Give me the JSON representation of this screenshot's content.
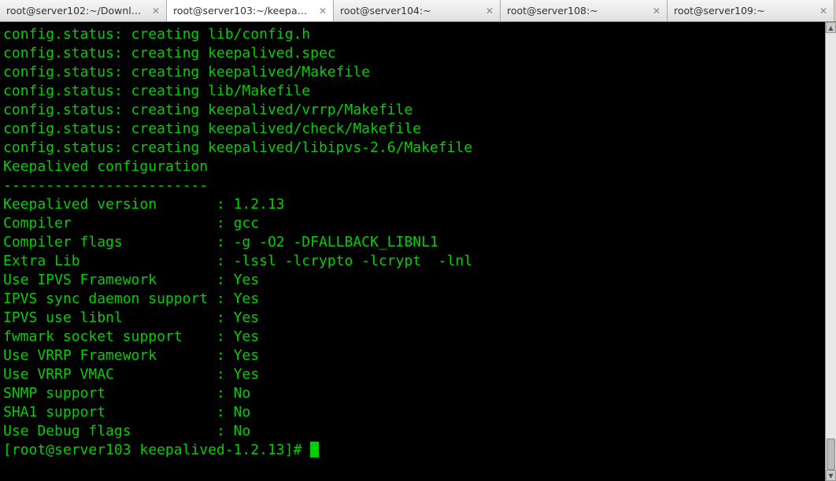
{
  "tabs": [
    {
      "label": "root@server102:~/Downl…",
      "active": false
    },
    {
      "label": "root@server103:~/keepa…",
      "active": true
    },
    {
      "label": "root@server104:~",
      "active": false
    },
    {
      "label": "root@server108:~",
      "active": false
    },
    {
      "label": "root@server109:~",
      "active": false
    }
  ],
  "terminal": {
    "lines": [
      "config.status: creating lib/config.h",
      "config.status: creating keepalived.spec",
      "config.status: creating keepalived/Makefile",
      "config.status: creating lib/Makefile",
      "config.status: creating keepalived/vrrp/Makefile",
      "config.status: creating keepalived/check/Makefile",
      "config.status: creating keepalived/libipvs-2.6/Makefile",
      "",
      "Keepalived configuration",
      "------------------------",
      "Keepalived version       : 1.2.13",
      "Compiler                 : gcc",
      "Compiler flags           : -g -O2 -DFALLBACK_LIBNL1",
      "Extra Lib                : -lssl -lcrypto -lcrypt  -lnl",
      "Use IPVS Framework       : Yes",
      "IPVS sync daemon support : Yes",
      "IPVS use libnl           : Yes",
      "fwmark socket support    : Yes",
      "Use VRRP Framework       : Yes",
      "Use VRRP VMAC            : Yes",
      "SNMP support             : No",
      "SHA1 support             : No",
      "Use Debug flags          : No"
    ],
    "prompt": "[root@server103 keepalived-1.2.13]# "
  },
  "colors": {
    "terminal_bg": "#000000",
    "terminal_fg": "#00d000"
  }
}
